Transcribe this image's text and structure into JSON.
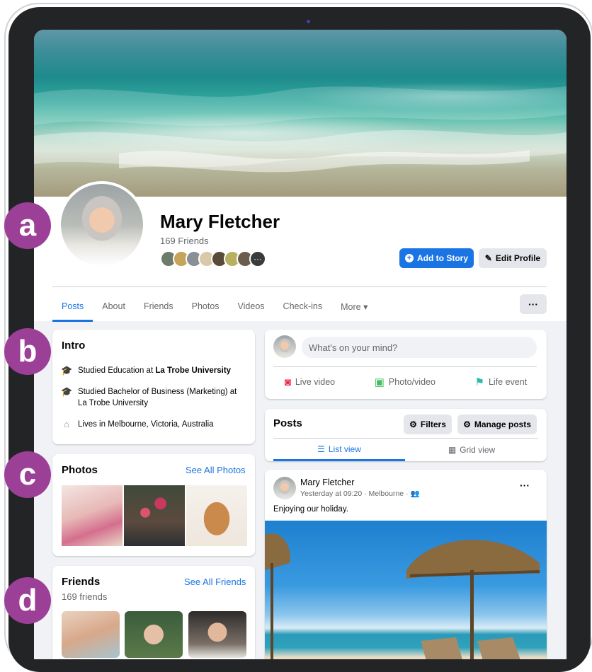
{
  "profile": {
    "name": "Mary Fletcher",
    "friends_count": "169 Friends",
    "add_story_label": "Add to Story",
    "edit_profile_label": "Edit Profile",
    "more_friends_glyph": "···"
  },
  "tabs": [
    {
      "label": "Posts"
    },
    {
      "label": "About"
    },
    {
      "label": "Friends"
    },
    {
      "label": "Photos"
    },
    {
      "label": "Videos"
    },
    {
      "label": "Check-ins"
    },
    {
      "label": "More ▾"
    }
  ],
  "tab_overflow_label": "···",
  "intro": {
    "title": "Intro",
    "items": [
      {
        "icon": "graduation-cap-icon",
        "text": "Studied Education at ",
        "bold": "La Trobe University"
      },
      {
        "icon": "graduation-cap-icon",
        "text": "Studied Bachelor of Business (Marketing) at",
        "bold": "La Trobe University"
      },
      {
        "icon": "home-icon",
        "text": "Lives in ",
        "bold": "Melbourne, Victoria, Australia"
      }
    ]
  },
  "photos": {
    "title": "Photos",
    "see_all": "See All Photos"
  },
  "friends": {
    "title": "Friends",
    "count": "169 friends",
    "see_all": "See All Friends"
  },
  "composer": {
    "placeholder": "What's on your mind?",
    "actions": [
      {
        "label": "Live video",
        "icon": "live-video-icon"
      },
      {
        "label": "Photo/video",
        "icon": "photo-icon"
      },
      {
        "label": "Life event",
        "icon": "flag-icon"
      }
    ]
  },
  "posts_section": {
    "title": "Posts",
    "filters_label": "Filters",
    "manage_label": "Manage posts",
    "list_view_label": "List view",
    "grid_view_label": "Grid view"
  },
  "post": {
    "author": "Mary Fletcher",
    "meta": "Yesterday at 09:20 · Melbourne · ",
    "text": "Enjoying our holiday.",
    "menu_glyph": "···"
  },
  "labels": [
    "a",
    "b",
    "c",
    "d"
  ],
  "colors": {
    "accent": "#1b74e4",
    "badge": "#9c3f97"
  }
}
